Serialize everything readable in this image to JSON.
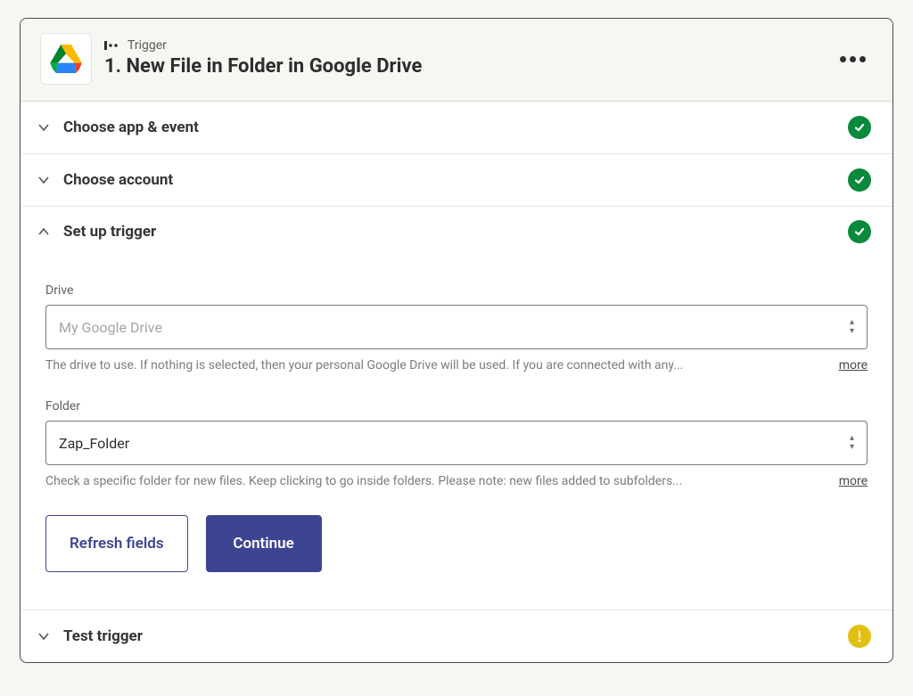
{
  "header": {
    "kicker": "Trigger",
    "title": "1. New File in Folder in Google Drive",
    "app_icon_name": "google-drive-icon"
  },
  "sections": {
    "choose_app_event": {
      "title": "Choose app & event",
      "status": "ok"
    },
    "choose_account": {
      "title": "Choose account",
      "status": "ok"
    },
    "setup_trigger": {
      "title": "Set up trigger",
      "status": "ok"
    },
    "test_trigger": {
      "title": "Test trigger",
      "status": "warn"
    }
  },
  "setup": {
    "drive": {
      "label": "Drive",
      "placeholder": "My Google Drive",
      "help": "The drive to use. If nothing is selected, then your personal Google Drive will be used. If you are connected with any...",
      "more": "more"
    },
    "folder": {
      "label": "Folder",
      "value": "Zap_Folder",
      "help": "Check a specific folder for new files. Keep clicking to go inside folders. Please note: new files added to subfolders...",
      "more": "more"
    },
    "buttons": {
      "refresh": "Refresh fields",
      "continue": "Continue"
    }
  },
  "colors": {
    "status_ok": "#09893c",
    "status_warn": "#e2c012",
    "primary": "#3d4592"
  }
}
